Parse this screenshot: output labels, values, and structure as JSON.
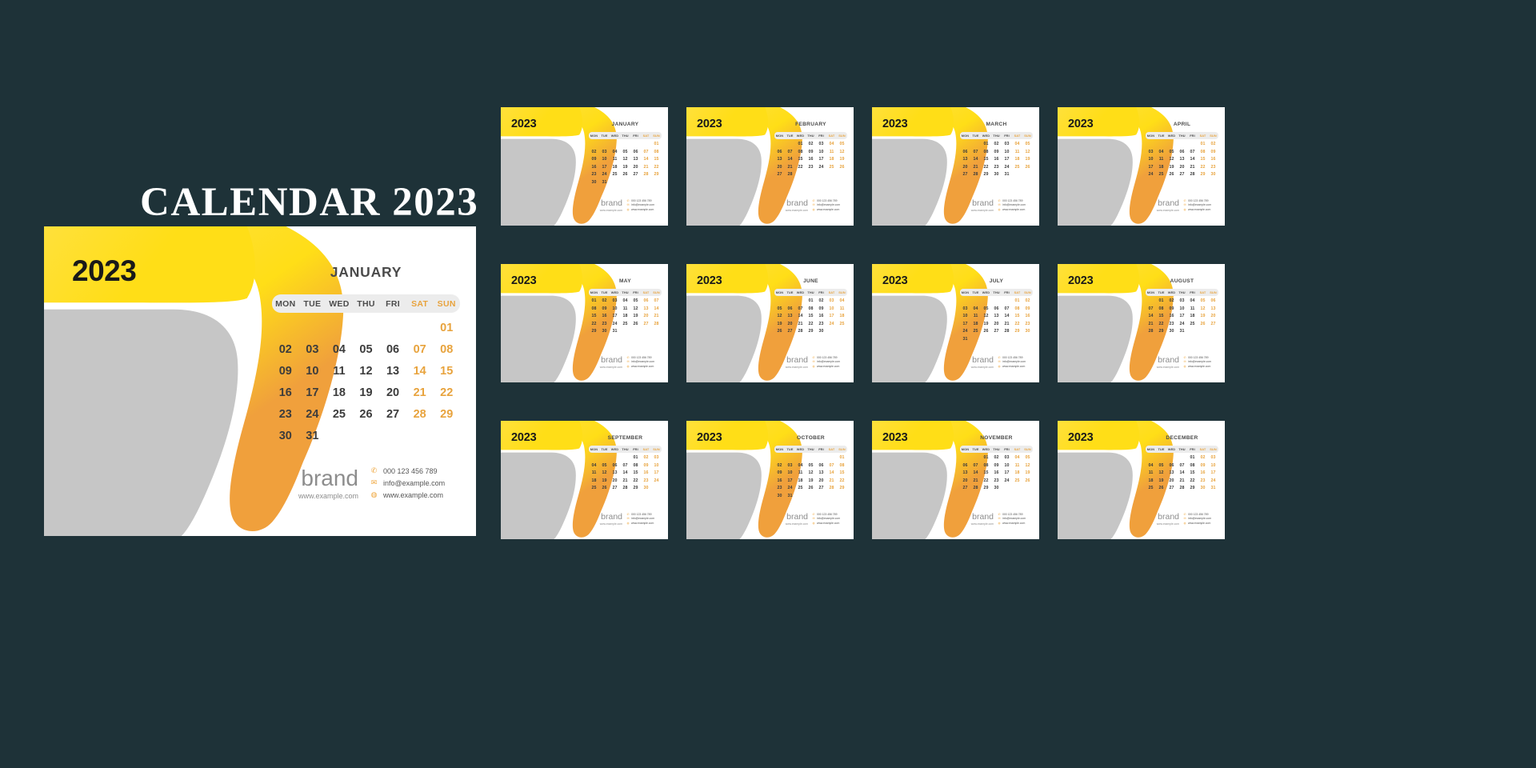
{
  "page": {
    "title": "CALENDAR 2023",
    "background_color": "#1e3238",
    "year": "2023"
  },
  "theme": {
    "yellow": "#FFE03B",
    "yellow_deep": "#FFDE17",
    "orange": "#F0A03C",
    "gray_blob": "#C6C6C6",
    "weekend_text": "#E8A33D",
    "weekday_text": "#3C3C3C",
    "header_pill": "#ECECEC",
    "card_bg": "#FFFFFF",
    "title_text": "#FFFFFF"
  },
  "weekdays": [
    "MON",
    "TUE",
    "WED",
    "THU",
    "FRI",
    "SAT",
    "SUN"
  ],
  "brand": {
    "name": "brand",
    "site": "www.example.com",
    "contacts": [
      {
        "icon": "phone-icon",
        "glyph": "✆",
        "text": "000 123 456 789"
      },
      {
        "icon": "mail-icon",
        "glyph": "✉",
        "text": "info@example.com"
      },
      {
        "icon": "globe-icon",
        "glyph": "◍",
        "text": "www.example.com"
      }
    ]
  },
  "months": [
    {
      "name": "JANUARY",
      "lead": 6,
      "days": 31
    },
    {
      "name": "FEBRUARY",
      "lead": 2,
      "days": 28
    },
    {
      "name": "MARCH",
      "lead": 2,
      "days": 31
    },
    {
      "name": "APRIL",
      "lead": 5,
      "days": 30
    },
    {
      "name": "MAY",
      "lead": 0,
      "days": 31
    },
    {
      "name": "JUNE",
      "lead": 3,
      "days": 30
    },
    {
      "name": "JULY",
      "lead": 5,
      "days": 31
    },
    {
      "name": "AUGUST",
      "lead": 1,
      "days": 31
    },
    {
      "name": "SEPTEMBER",
      "lead": 4,
      "days": 30
    },
    {
      "name": "OCTOBER",
      "lead": 6,
      "days": 31
    },
    {
      "name": "NOVEMBER",
      "lead": 2,
      "days": 30
    },
    {
      "name": "DECEMBER",
      "lead": 4,
      "days": 31
    }
  ],
  "featured_month_index": 0,
  "thumbnail_grid": {
    "columns": 4,
    "rows": 3
  }
}
